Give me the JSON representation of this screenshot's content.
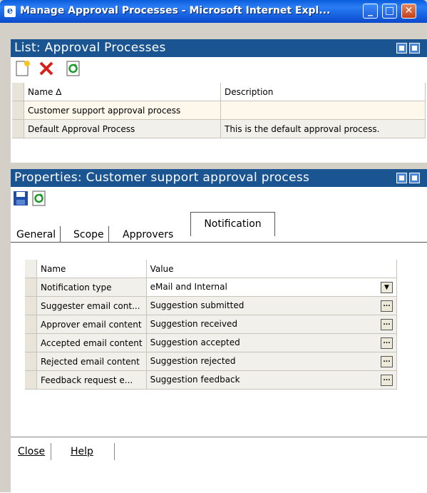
{
  "window": {
    "title": "Manage Approval Processes - Microsoft Internet Expl...",
    "min_glyph": "_",
    "max_glyph": "□",
    "close_glyph": "✕"
  },
  "list_panel": {
    "title": "List: Approval Processes",
    "columns": [
      "Name ∆",
      "Description"
    ],
    "rows": [
      {
        "name": "Customer support approval process",
        "description": ""
      },
      {
        "name": "Default Approval Process",
        "description": "This is the default approval process."
      }
    ]
  },
  "properties_panel": {
    "title": "Properties: Customer support approval process",
    "tabs": [
      "General",
      "Scope",
      "Approvers",
      "Notification"
    ],
    "active_tab": "Notification",
    "columns": [
      "Name",
      "Value"
    ],
    "rows": [
      {
        "name": "Notification type",
        "value": "eMail and Internal"
      },
      {
        "name": "Suggester email cont...",
        "value": "Suggestion submitted"
      },
      {
        "name": "Approver email content",
        "value": "Suggestion received"
      },
      {
        "name": "Accepted email content",
        "value": "Suggestion accepted"
      },
      {
        "name": "Rejected email content",
        "value": "Suggestion rejected"
      },
      {
        "name": "Feedback request e...",
        "value": "Suggestion feedback"
      }
    ]
  },
  "footer": {
    "close_label": "Close",
    "help_label": "Help"
  },
  "colors": {
    "panel_header": "#1a5591",
    "titlebar": "#2b7df5",
    "selected_row": "#fdf7ec"
  },
  "icons": [
    "ie-icon",
    "new-document-icon",
    "delete-icon",
    "refresh-icon",
    "save-icon",
    "dropdown-icon",
    "ellipsis-icon"
  ]
}
